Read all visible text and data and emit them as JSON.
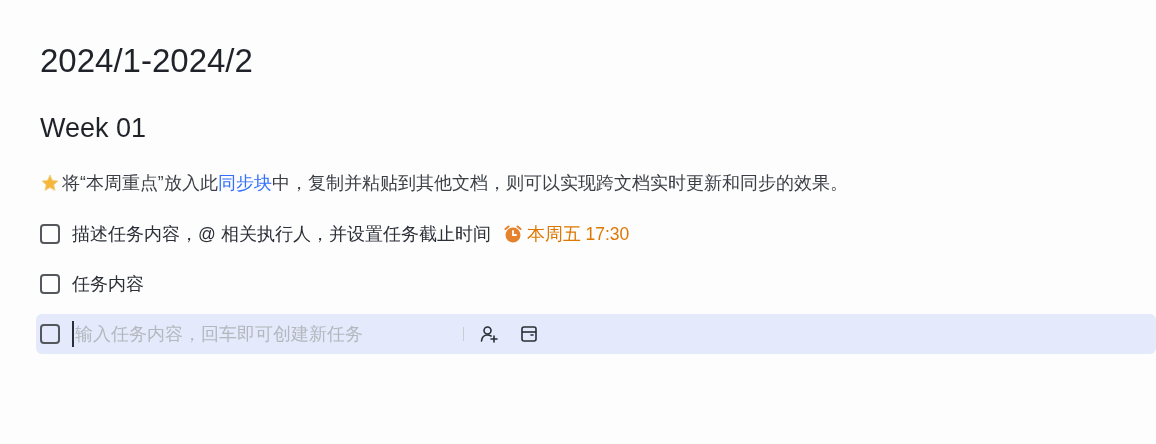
{
  "title": "2024/1-2024/2",
  "heading": "Week 01",
  "note": {
    "before": "将“本周重点”放入此",
    "link": "同步块",
    "after": "中，复制并粘贴到其他文档，则可以实现跨文档实时更新和同步的效果。"
  },
  "tasks": [
    {
      "kind": "task",
      "text": "描述任务内容，@ 相关执行人，并设置任务截止时间",
      "checked": false,
      "due": "本周五 17:30"
    },
    {
      "kind": "task",
      "text": "任务内容",
      "checked": false
    },
    {
      "kind": "new",
      "placeholder": "输入任务内容，回车即可创建新任务",
      "checked": false
    }
  ]
}
